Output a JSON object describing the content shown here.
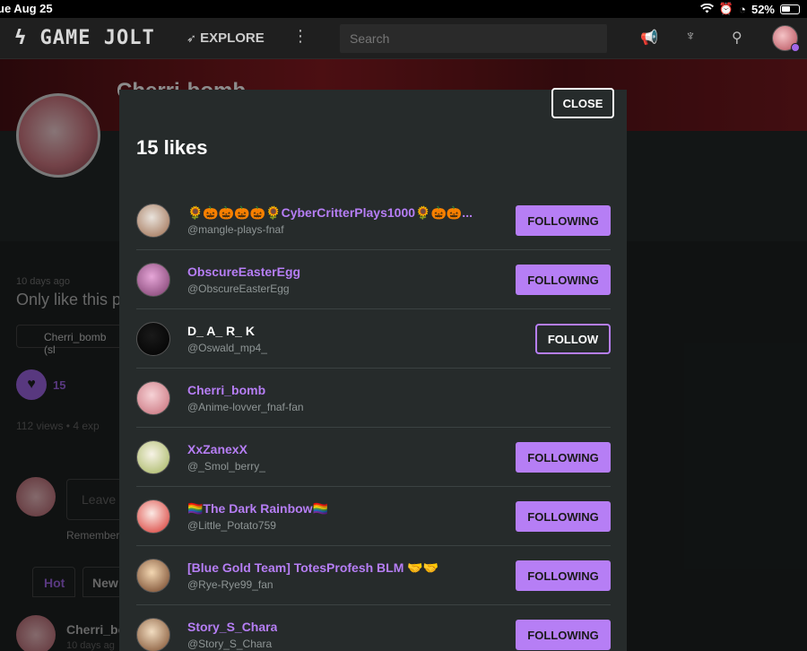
{
  "statusbar": {
    "datetime": "ue Aug 25",
    "battery": "52%"
  },
  "nav": {
    "logo": "ϟ GAME JOLT",
    "explore": "EXPLORE",
    "search_placeholder": "Search"
  },
  "background": {
    "title": "Cherri-bomb",
    "time": "10 days ago",
    "post": "Only like this p",
    "chip": "Cherri_bomb (sl",
    "like_count": "15",
    "views": "112 views  •  4 exp",
    "leave": "Leave",
    "remember": "Remember",
    "tab_hot": "Hot",
    "tab_new": "New",
    "comment_name": "Cherri_bo",
    "comment_time": "10 days ag"
  },
  "modal": {
    "title": "15 likes",
    "close_label": "CLOSE",
    "users": [
      {
        "name": "🌻🎃🎃🎃🎃🌻CyberCritterPlays1000🌻🎃🎃...",
        "handle": "@mangle-plays-fnaf",
        "button": "FOLLOWING",
        "name_color": "#b67ef5",
        "avatar_colors": [
          "#e9e3dc",
          "#9c6b4c"
        ]
      },
      {
        "name": "ObscureEasterEgg",
        "handle": "@ObscureEasterEgg",
        "button": "FOLLOWING",
        "name_color": "#b67ef5",
        "avatar_colors": [
          "#e6a6d8",
          "#7a3b6b"
        ]
      },
      {
        "name": "D_ A_ R_ K",
        "handle": "@Oswald_mp4_",
        "button": "FOLLOW",
        "name_color": "#ffffff",
        "avatar_colors": [
          "#1a1a1a",
          "#000000"
        ]
      },
      {
        "name": "Cherri_bomb",
        "handle": "@Anime-lovver_fnaf-fan",
        "button": "",
        "name_color": "#b67ef5",
        "avatar_colors": [
          "#f6d2d6",
          "#c66c77"
        ]
      },
      {
        "name": "XxZanexX",
        "handle": "@_Smol_berry_",
        "button": "FOLLOWING",
        "name_color": "#b67ef5",
        "avatar_colors": [
          "#f7f3e6",
          "#a2b35a"
        ]
      },
      {
        "name": "🏳️‍🌈The Dark Rainbow🏳️‍🌈",
        "handle": "@Little_Potato759",
        "button": "FOLLOWING",
        "name_color": "#b67ef5",
        "avatar_colors": [
          "#fbe9e4",
          "#d7322c"
        ]
      },
      {
        "name": "[Blue Gold Team] TotesProfesh BLM 🤝🤝",
        "handle": "@Rye-Rye99_fan",
        "button": "FOLLOWING",
        "name_color": "#b67ef5",
        "avatar_colors": [
          "#f3d7b2",
          "#6c3d22"
        ]
      },
      {
        "name": "Story_S_Chara",
        "handle": "@Story_S_Chara",
        "button": "FOLLOWING",
        "name_color": "#b67ef5",
        "avatar_colors": [
          "#f1dcc0",
          "#7a4a2a"
        ]
      }
    ]
  },
  "colors": {
    "accent": "#b67ef5",
    "modal_bg": "#262b2b",
    "page_bg": "#1e2222"
  }
}
